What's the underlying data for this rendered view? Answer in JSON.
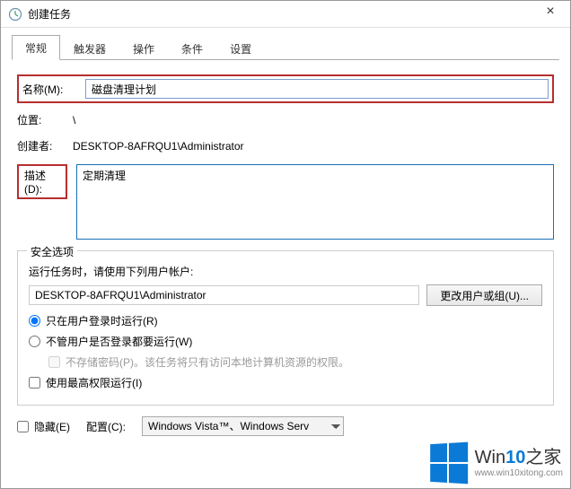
{
  "window": {
    "title": "创建任务",
    "close": "×"
  },
  "tabs": [
    {
      "label": "常规",
      "active": true
    },
    {
      "label": "触发器",
      "active": false
    },
    {
      "label": "操作",
      "active": false
    },
    {
      "label": "条件",
      "active": false
    },
    {
      "label": "设置",
      "active": false
    }
  ],
  "form": {
    "name_label": "名称(M):",
    "name_value": "磁盘清理计划",
    "location_label": "位置:",
    "location_value": "\\",
    "creator_label": "创建者:",
    "creator_value": "DESKTOP-8AFRQU1\\Administrator",
    "desc_label": "描述(D):",
    "desc_value": "定期清理"
  },
  "security": {
    "legend": "安全选项",
    "prompt": "运行任务时，请使用下列用户帐户:",
    "account": "DESKTOP-8AFRQU1\\Administrator",
    "change_user_btn": "更改用户或组(U)...",
    "radio_logged_on": "只在用户登录时运行(R)",
    "radio_any": "不管用户是否登录都要运行(W)",
    "no_store_pw": "不存储密码(P)。该任务将只有访问本地计算机资源的权限。",
    "highest_priv": "使用最高权限运行(I)"
  },
  "bottom": {
    "hidden_label": "隐藏(E)",
    "config_label": "配置(C):",
    "config_value": "Windows Vista™、Windows Serv"
  },
  "watermark": {
    "brand_prefix": "Win",
    "brand_num": "10",
    "brand_suffix": "之家",
    "url": "www.win10xitong.com"
  }
}
